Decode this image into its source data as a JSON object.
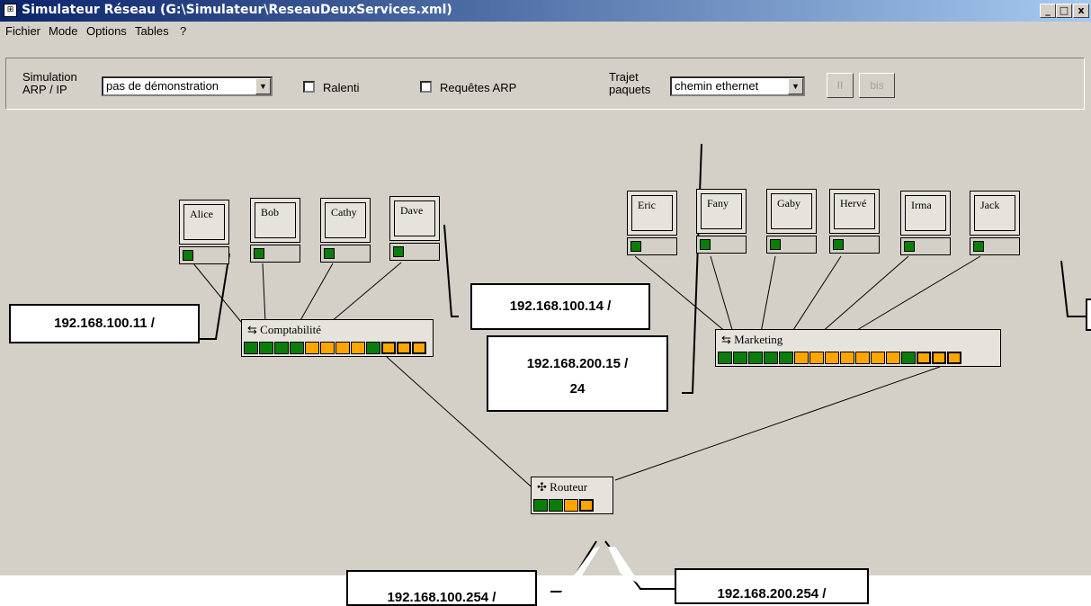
{
  "window": {
    "title": "Simulateur Réseau (G:\\Simulateur\\ReseauDeuxServices.xml)",
    "controls": [
      "_",
      "□",
      "x"
    ]
  },
  "menu": [
    "Fichier",
    "Mode",
    "Options",
    "Tables",
    "?"
  ],
  "toolbar": {
    "sim_label_1": "Simulation",
    "sim_label_2": "ARP / IP",
    "sim_value": "pas de démonstration",
    "ralenti_label": "Ralenti",
    "ralenti_checked": false,
    "arp_label": "Requêtes ARP",
    "arp_checked": false,
    "trajet_label_1": "Trajet",
    "trajet_label_2": "paquets",
    "trajet_value": "chemin ethernet",
    "pause_label": "II",
    "bis_label": "bis"
  },
  "network": {
    "hosts_left": [
      "Alice",
      "Bob",
      "Cathy",
      "Dave"
    ],
    "hosts_right": [
      "Eric",
      "Fany",
      "Gaby",
      "Hervé",
      "Irma",
      "Jack"
    ],
    "switch_left": {
      "label": "Comptabilité",
      "ports": [
        "g",
        "g",
        "g",
        "g",
        "o",
        "o",
        "o",
        "o",
        "g",
        "y",
        "y",
        "y"
      ]
    },
    "switch_right": {
      "label": "Marketing",
      "ports": [
        "g",
        "g",
        "g",
        "g",
        "g",
        "o",
        "o",
        "o",
        "o",
        "o",
        "o",
        "o",
        "g",
        "y",
        "y",
        "y"
      ]
    },
    "router": {
      "label": "Routeur",
      "ports": [
        "g",
        "g",
        "o",
        "y"
      ]
    }
  },
  "callouts": {
    "alice_ip": "192.168.100.11 /",
    "dave_ip": "192.168.100.14 /",
    "fany_ip_1": "192.168.200.15 /",
    "fany_ip_2": "24",
    "router_ip_1": "192.168.100.254 /",
    "router_ip_2": "192.168.200.254 /"
  },
  "colors": {
    "port_active": "#0a7d0a",
    "port_idle": "#ffa500",
    "window_bg": "#d4d0c8"
  }
}
